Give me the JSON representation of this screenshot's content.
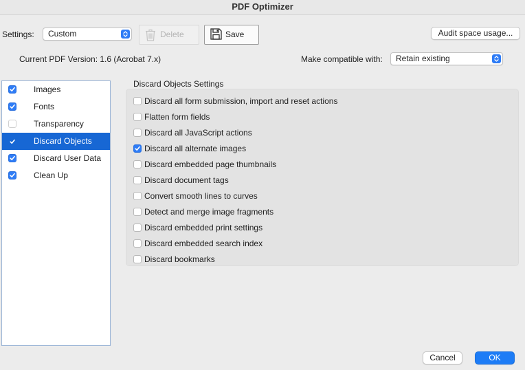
{
  "window": {
    "title": "PDF Optimizer"
  },
  "toolbar": {
    "settings_label": "Settings:",
    "settings_value": "Custom",
    "delete_label": "Delete",
    "save_label": "Save",
    "audit_label": "Audit space usage..."
  },
  "version": {
    "current_label": "Current PDF Version: 1.6 (Acrobat 7.x)",
    "compat_label": "Make compatible with:",
    "compat_value": "Retain existing"
  },
  "sidebar": {
    "items": [
      {
        "label": "Images",
        "checked": true,
        "selected": false
      },
      {
        "label": "Fonts",
        "checked": true,
        "selected": false
      },
      {
        "label": "Transparency",
        "checked": false,
        "selected": false
      },
      {
        "label": "Discard Objects",
        "checked": true,
        "selected": true
      },
      {
        "label": "Discard User Data",
        "checked": true,
        "selected": false
      },
      {
        "label": "Clean Up",
        "checked": true,
        "selected": false
      }
    ]
  },
  "discard": {
    "title": "Discard Objects Settings",
    "options": [
      {
        "label": "Discard all form submission, import and reset actions",
        "checked": false
      },
      {
        "label": "Flatten form fields",
        "checked": false
      },
      {
        "label": "Discard all JavaScript actions",
        "checked": false
      },
      {
        "label": "Discard all alternate images",
        "checked": true
      },
      {
        "label": "Discard embedded page thumbnails",
        "checked": false
      },
      {
        "label": "Discard document tags",
        "checked": false
      },
      {
        "label": "Convert smooth lines to curves",
        "checked": false
      },
      {
        "label": "Detect and merge image fragments",
        "checked": false
      },
      {
        "label": "Discard embedded print settings",
        "checked": false
      },
      {
        "label": "Discard embedded search index",
        "checked": false
      },
      {
        "label": "Discard bookmarks",
        "checked": false
      }
    ]
  },
  "footer": {
    "cancel_label": "Cancel",
    "ok_label": "OK"
  },
  "colors": {
    "accent": "#1d7cf6",
    "selection": "#1767d4"
  },
  "icons": {
    "delete": "trash-icon",
    "save": "floppy-disk-icon",
    "popup": "chevron-up-down-icon",
    "check": "checkmark-icon"
  }
}
